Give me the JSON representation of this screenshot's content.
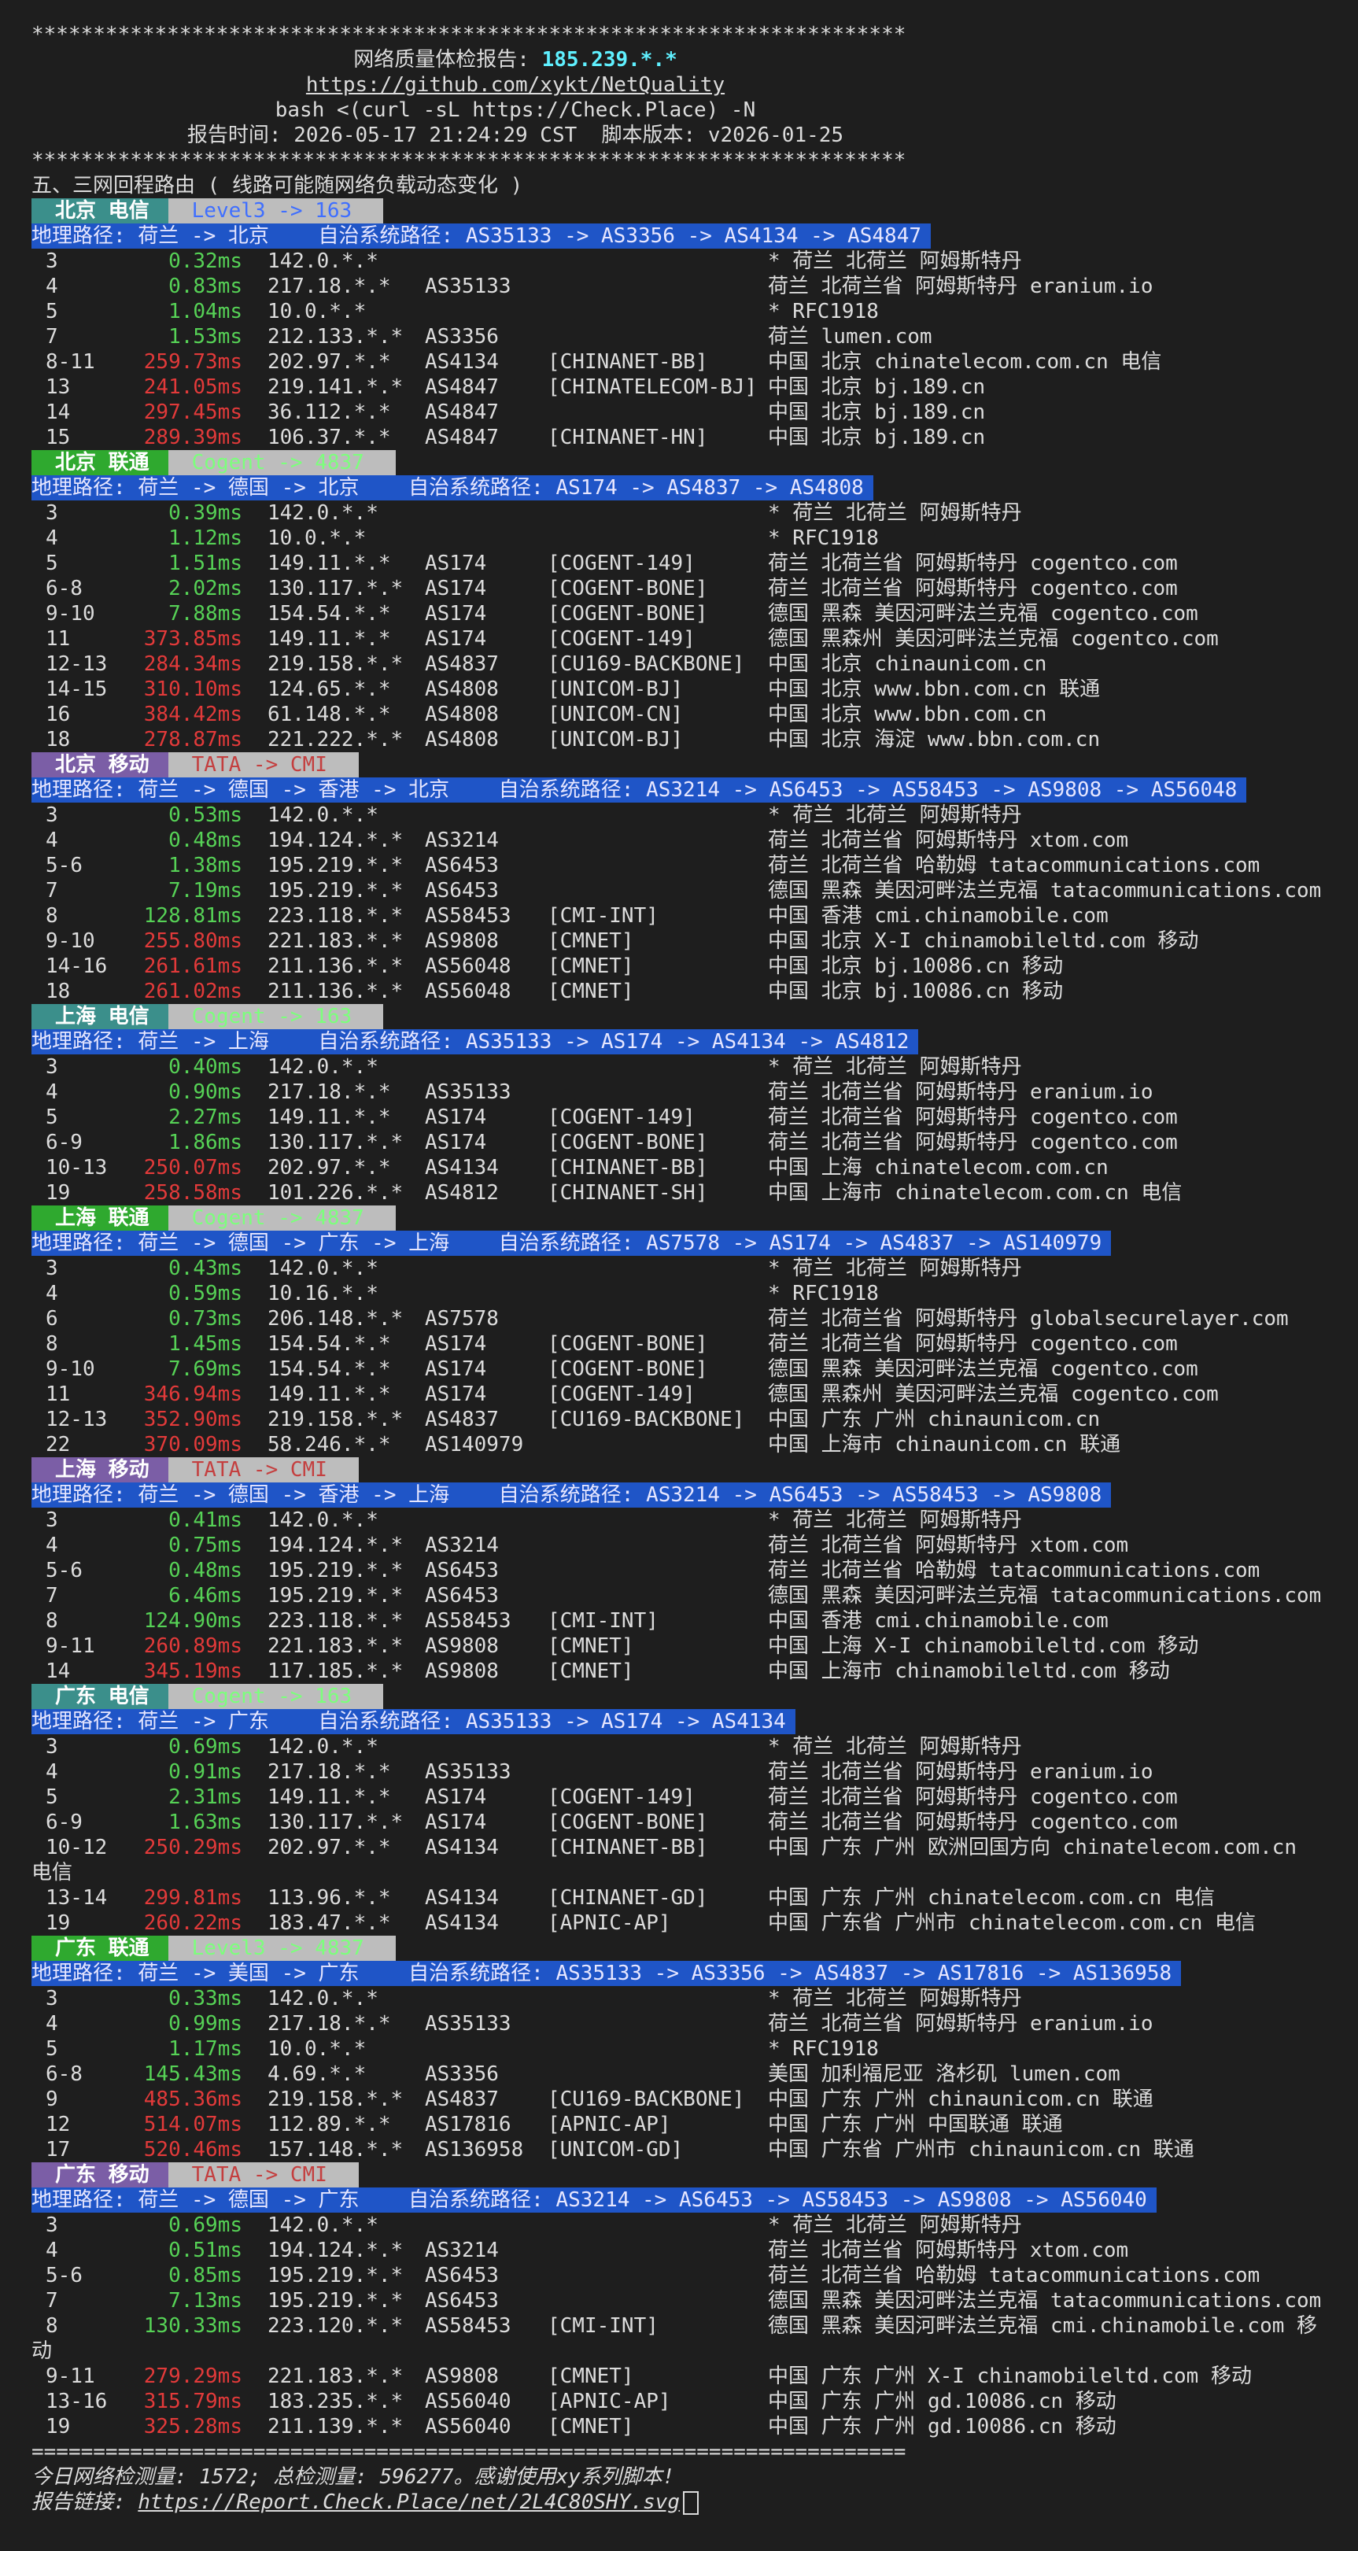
{
  "stars": "***********************************************************************",
  "header": {
    "title": "网络质量体检报告: ",
    "ip": "185.239.*.*",
    "repo": "https://github.com/xykt/NetQuality",
    "cmd": "bash <(curl -sL https://Check.Place) -N",
    "report_time": "报告时间: 2026-05-17 21:24:29 CST  脚本版本: v2026-01-25"
  },
  "section_title": "五、三网回程路由 ( 线路可能随网络负载动态变化 )",
  "routes": [
    {
      "label": "北京 电信",
      "carrier": "ct",
      "provider": "Level3 -> 163",
      "provider_style": "level3",
      "geo": "地理路径: 荷兰 -> 北京    自治系统路径: AS35133 -> AS3356 -> AS4134 -> AS4847",
      "hops": [
        {
          "n": "3",
          "ms": "0.32ms",
          "c": "g",
          "ip": "142.0.*.*",
          "as": "",
          "net": "",
          "loc": "* 荷兰 北荷兰 阿姆斯特丹"
        },
        {
          "n": "4",
          "ms": "0.83ms",
          "c": "g",
          "ip": "217.18.*.*",
          "as": "AS35133",
          "net": "",
          "loc": "荷兰 北荷兰省 阿姆斯特丹 eranium.io"
        },
        {
          "n": "5",
          "ms": "1.04ms",
          "c": "g",
          "ip": "10.0.*.*",
          "as": "",
          "net": "",
          "loc": "* RFC1918"
        },
        {
          "n": "7",
          "ms": "1.53ms",
          "c": "g",
          "ip": "212.133.*.*",
          "as": "AS3356",
          "net": "",
          "loc": "荷兰 lumen.com"
        },
        {
          "n": "8-11",
          "ms": "259.73ms",
          "c": "r",
          "ip": "202.97.*.*",
          "as": "AS4134",
          "net": "[CHINANET-BB]",
          "loc": "中国 北京 chinatelecom.com.cn 电信"
        },
        {
          "n": "13",
          "ms": "241.05ms",
          "c": "r",
          "ip": "219.141.*.*",
          "as": "AS4847",
          "net": "[CHINATELECOM-BJ]",
          "loc": "中国 北京 bj.189.cn"
        },
        {
          "n": "14",
          "ms": "297.45ms",
          "c": "r",
          "ip": "36.112.*.*",
          "as": "AS4847",
          "net": "",
          "loc": "中国 北京 bj.189.cn"
        },
        {
          "n": "15",
          "ms": "289.39ms",
          "c": "r",
          "ip": "106.37.*.*",
          "as": "AS4847",
          "net": "[CHINANET-HN]",
          "loc": "中国 北京 bj.189.cn"
        }
      ]
    },
    {
      "label": "北京 联通",
      "carrier": "cu",
      "provider": "Cogent -> 4837",
      "provider_style": "cogent",
      "geo": "地理路径: 荷兰 -> 德国 -> 北京    自治系统路径: AS174 -> AS4837 -> AS4808",
      "hops": [
        {
          "n": "3",
          "ms": "0.39ms",
          "c": "g",
          "ip": "142.0.*.*",
          "as": "",
          "net": "",
          "loc": "* 荷兰 北荷兰 阿姆斯特丹"
        },
        {
          "n": "4",
          "ms": "1.12ms",
          "c": "g",
          "ip": "10.0.*.*",
          "as": "",
          "net": "",
          "loc": "* RFC1918"
        },
        {
          "n": "5",
          "ms": "1.51ms",
          "c": "g",
          "ip": "149.11.*.*",
          "as": "AS174",
          "net": "[COGENT-149]",
          "loc": "荷兰 北荷兰省 阿姆斯特丹 cogentco.com"
        },
        {
          "n": "6-8",
          "ms": "2.02ms",
          "c": "g",
          "ip": "130.117.*.*",
          "as": "AS174",
          "net": "[COGENT-BONE]",
          "loc": "荷兰 北荷兰省 阿姆斯特丹 cogentco.com"
        },
        {
          "n": "9-10",
          "ms": "7.88ms",
          "c": "g",
          "ip": "154.54.*.*",
          "as": "AS174",
          "net": "[COGENT-BONE]",
          "loc": "德国 黑森 美因河畔法兰克福 cogentco.com"
        },
        {
          "n": "11",
          "ms": "373.85ms",
          "c": "r",
          "ip": "149.11.*.*",
          "as": "AS174",
          "net": "[COGENT-149]",
          "loc": "德国 黑森州 美因河畔法兰克福 cogentco.com"
        },
        {
          "n": "12-13",
          "ms": "284.34ms",
          "c": "r",
          "ip": "219.158.*.*",
          "as": "AS4837",
          "net": "[CU169-BACKBONE]",
          "loc": "中国 北京 chinaunicom.cn"
        },
        {
          "n": "14-15",
          "ms": "310.10ms",
          "c": "r",
          "ip": "124.65.*.*",
          "as": "AS4808",
          "net": "[UNICOM-BJ]",
          "loc": "中国 北京 www.bbn.com.cn 联通"
        },
        {
          "n": "16",
          "ms": "384.42ms",
          "c": "r",
          "ip": "61.148.*.*",
          "as": "AS4808",
          "net": "[UNICOM-CN]",
          "loc": "中国 北京 www.bbn.com.cn"
        },
        {
          "n": "18",
          "ms": "278.87ms",
          "c": "r",
          "ip": "221.222.*.*",
          "as": "AS4808",
          "net": "[UNICOM-BJ]",
          "loc": "中国 北京 海淀 www.bbn.com.cn"
        }
      ]
    },
    {
      "label": "北京 移动",
      "carrier": "cm",
      "provider": "TATA -> CMI",
      "provider_style": "tata",
      "geo": "地理路径: 荷兰 -> 德国 -> 香港 -> 北京    自治系统路径: AS3214 -> AS6453 -> AS58453 -> AS9808 -> AS56048",
      "hops": [
        {
          "n": "3",
          "ms": "0.53ms",
          "c": "g",
          "ip": "142.0.*.*",
          "as": "",
          "net": "",
          "loc": "* 荷兰 北荷兰 阿姆斯特丹"
        },
        {
          "n": "4",
          "ms": "0.48ms",
          "c": "g",
          "ip": "194.124.*.*",
          "as": "AS3214",
          "net": "",
          "loc": "荷兰 北荷兰省 阿姆斯特丹 xtom.com"
        },
        {
          "n": "5-6",
          "ms": "1.38ms",
          "c": "g",
          "ip": "195.219.*.*",
          "as": "AS6453",
          "net": "",
          "loc": "荷兰 北荷兰省 哈勒姆 tatacommunications.com"
        },
        {
          "n": "7",
          "ms": "7.19ms",
          "c": "g",
          "ip": "195.219.*.*",
          "as": "AS6453",
          "net": "",
          "loc": "德国 黑森 美因河畔法兰克福 tatacommunications.com"
        },
        {
          "n": "8",
          "ms": "128.81ms",
          "c": "g",
          "ip": "223.118.*.*",
          "as": "AS58453",
          "net": "[CMI-INT]",
          "loc": "中国 香港 cmi.chinamobile.com"
        },
        {
          "n": "9-10",
          "ms": "255.80ms",
          "c": "r",
          "ip": "221.183.*.*",
          "as": "AS9808",
          "net": "[CMNET]",
          "loc": "中国 北京 X-I chinamobileltd.com 移动"
        },
        {
          "n": "14-16",
          "ms": "261.61ms",
          "c": "r",
          "ip": "211.136.*.*",
          "as": "AS56048",
          "net": "[CMNET]",
          "loc": "中国 北京 bj.10086.cn 移动"
        },
        {
          "n": "18",
          "ms": "261.02ms",
          "c": "r",
          "ip": "211.136.*.*",
          "as": "AS56048",
          "net": "[CMNET]",
          "loc": "中国 北京 bj.10086.cn 移动"
        }
      ]
    },
    {
      "label": "上海 电信",
      "carrier": "ct",
      "provider": "Cogent -> 163",
      "provider_style": "cogent",
      "geo": "地理路径: 荷兰 -> 上海    自治系统路径: AS35133 -> AS174 -> AS4134 -> AS4812",
      "hops": [
        {
          "n": "3",
          "ms": "0.40ms",
          "c": "g",
          "ip": "142.0.*.*",
          "as": "",
          "net": "",
          "loc": "* 荷兰 北荷兰 阿姆斯特丹"
        },
        {
          "n": "4",
          "ms": "0.90ms",
          "c": "g",
          "ip": "217.18.*.*",
          "as": "AS35133",
          "net": "",
          "loc": "荷兰 北荷兰省 阿姆斯特丹 eranium.io"
        },
        {
          "n": "5",
          "ms": "2.27ms",
          "c": "g",
          "ip": "149.11.*.*",
          "as": "AS174",
          "net": "[COGENT-149]",
          "loc": "荷兰 北荷兰省 阿姆斯特丹 cogentco.com"
        },
        {
          "n": "6-9",
          "ms": "1.86ms",
          "c": "g",
          "ip": "130.117.*.*",
          "as": "AS174",
          "net": "[COGENT-BONE]",
          "loc": "荷兰 北荷兰省 阿姆斯特丹 cogentco.com"
        },
        {
          "n": "10-13",
          "ms": "250.07ms",
          "c": "r",
          "ip": "202.97.*.*",
          "as": "AS4134",
          "net": "[CHINANET-BB]",
          "loc": "中国 上海 chinatelecom.com.cn"
        },
        {
          "n": "19",
          "ms": "258.58ms",
          "c": "r",
          "ip": "101.226.*.*",
          "as": "AS4812",
          "net": "[CHINANET-SH]",
          "loc": "中国 上海市 chinatelecom.com.cn 电信"
        }
      ]
    },
    {
      "label": "上海 联通",
      "carrier": "cu",
      "provider": "Cogent -> 4837",
      "provider_style": "cogent",
      "geo": "地理路径: 荷兰 -> 德国 -> 广东 -> 上海    自治系统路径: AS7578 -> AS174 -> AS4837 -> AS140979",
      "hops": [
        {
          "n": "3",
          "ms": "0.43ms",
          "c": "g",
          "ip": "142.0.*.*",
          "as": "",
          "net": "",
          "loc": "* 荷兰 北荷兰 阿姆斯特丹"
        },
        {
          "n": "4",
          "ms": "0.59ms",
          "c": "g",
          "ip": "10.16.*.*",
          "as": "",
          "net": "",
          "loc": "* RFC1918"
        },
        {
          "n": "6",
          "ms": "0.73ms",
          "c": "g",
          "ip": "206.148.*.*",
          "as": "AS7578",
          "net": "",
          "loc": "荷兰 北荷兰省 阿姆斯特丹 globalsecurelayer.com"
        },
        {
          "n": "8",
          "ms": "1.45ms",
          "c": "g",
          "ip": "154.54.*.*",
          "as": "AS174",
          "net": "[COGENT-BONE]",
          "loc": "荷兰 北荷兰省 阿姆斯特丹 cogentco.com"
        },
        {
          "n": "9-10",
          "ms": "7.69ms",
          "c": "g",
          "ip": "154.54.*.*",
          "as": "AS174",
          "net": "[COGENT-BONE]",
          "loc": "德国 黑森 美因河畔法兰克福 cogentco.com"
        },
        {
          "n": "11",
          "ms": "346.94ms",
          "c": "r",
          "ip": "149.11.*.*",
          "as": "AS174",
          "net": "[COGENT-149]",
          "loc": "德国 黑森州 美因河畔法兰克福 cogentco.com"
        },
        {
          "n": "12-13",
          "ms": "352.90ms",
          "c": "r",
          "ip": "219.158.*.*",
          "as": "AS4837",
          "net": "[CU169-BACKBONE]",
          "loc": "中国 广东 广州 chinaunicom.cn"
        },
        {
          "n": "22",
          "ms": "370.09ms",
          "c": "r",
          "ip": "58.246.*.*",
          "as": "AS140979",
          "net": "",
          "loc": "中国 上海市 chinaunicom.cn 联通"
        }
      ]
    },
    {
      "label": "上海 移动",
      "carrier": "cm",
      "provider": "TATA -> CMI",
      "provider_style": "tata",
      "geo": "地理路径: 荷兰 -> 德国 -> 香港 -> 上海    自治系统路径: AS3214 -> AS6453 -> AS58453 -> AS9808",
      "hops": [
        {
          "n": "3",
          "ms": "0.41ms",
          "c": "g",
          "ip": "142.0.*.*",
          "as": "",
          "net": "",
          "loc": "* 荷兰 北荷兰 阿姆斯特丹"
        },
        {
          "n": "4",
          "ms": "0.75ms",
          "c": "g",
          "ip": "194.124.*.*",
          "as": "AS3214",
          "net": "",
          "loc": "荷兰 北荷兰省 阿姆斯特丹 xtom.com"
        },
        {
          "n": "5-6",
          "ms": "0.48ms",
          "c": "g",
          "ip": "195.219.*.*",
          "as": "AS6453",
          "net": "",
          "loc": "荷兰 北荷兰省 哈勒姆 tatacommunications.com"
        },
        {
          "n": "7",
          "ms": "6.46ms",
          "c": "g",
          "ip": "195.219.*.*",
          "as": "AS6453",
          "net": "",
          "loc": "德国 黑森 美因河畔法兰克福 tatacommunications.com"
        },
        {
          "n": "8",
          "ms": "124.90ms",
          "c": "g",
          "ip": "223.118.*.*",
          "as": "AS58453",
          "net": "[CMI-INT]",
          "loc": "中国 香港 cmi.chinamobile.com"
        },
        {
          "n": "9-11",
          "ms": "260.89ms",
          "c": "r",
          "ip": "221.183.*.*",
          "as": "AS9808",
          "net": "[CMNET]",
          "loc": "中国 上海 X-I chinamobileltd.com 移动"
        },
        {
          "n": "14",
          "ms": "345.19ms",
          "c": "r",
          "ip": "117.185.*.*",
          "as": "AS9808",
          "net": "[CMNET]",
          "loc": "中国 上海市 chinamobileltd.com 移动"
        }
      ]
    },
    {
      "label": "广东 电信",
      "carrier": "ct",
      "provider": "Cogent -> 163",
      "provider_style": "cogent",
      "geo": "地理路径: 荷兰 -> 广东    自治系统路径: AS35133 -> AS174 -> AS4134",
      "hops": [
        {
          "n": "3",
          "ms": "0.69ms",
          "c": "g",
          "ip": "142.0.*.*",
          "as": "",
          "net": "",
          "loc": "* 荷兰 北荷兰 阿姆斯特丹"
        },
        {
          "n": "4",
          "ms": "0.91ms",
          "c": "g",
          "ip": "217.18.*.*",
          "as": "AS35133",
          "net": "",
          "loc": "荷兰 北荷兰省 阿姆斯特丹 eranium.io"
        },
        {
          "n": "5",
          "ms": "2.31ms",
          "c": "g",
          "ip": "149.11.*.*",
          "as": "AS174",
          "net": "[COGENT-149]",
          "loc": "荷兰 北荷兰省 阿姆斯特丹 cogentco.com"
        },
        {
          "n": "6-9",
          "ms": "1.63ms",
          "c": "g",
          "ip": "130.117.*.*",
          "as": "AS174",
          "net": "[COGENT-BONE]",
          "loc": "荷兰 北荷兰省 阿姆斯特丹 cogentco.com"
        },
        {
          "n": "10-12",
          "ms": "250.29ms",
          "c": "r",
          "ip": "202.97.*.*",
          "as": "AS4134",
          "net": "[CHINANET-BB]",
          "loc": "中国 广东 广州 欧洲回国方向 chinatelecom.com.cn",
          "wrap": "电信"
        },
        {
          "n": "13-14",
          "ms": "299.81ms",
          "c": "r",
          "ip": "113.96.*.*",
          "as": "AS4134",
          "net": "[CHINANET-GD]",
          "loc": "中国 广东 广州 chinatelecom.com.cn 电信"
        },
        {
          "n": "19",
          "ms": "260.22ms",
          "c": "r",
          "ip": "183.47.*.*",
          "as": "AS4134",
          "net": "[APNIC-AP]",
          "loc": "中国 广东省 广州市 chinatelecom.com.cn 电信"
        }
      ]
    },
    {
      "label": "广东 联通",
      "carrier": "cu",
      "provider": "Level3 -> 4837",
      "provider_style": "cogent",
      "geo": "地理路径: 荷兰 -> 美国 -> 广东    自治系统路径: AS35133 -> AS3356 -> AS4837 -> AS17816 -> AS136958",
      "hops": [
        {
          "n": "3",
          "ms": "0.33ms",
          "c": "g",
          "ip": "142.0.*.*",
          "as": "",
          "net": "",
          "loc": "* 荷兰 北荷兰 阿姆斯特丹"
        },
        {
          "n": "4",
          "ms": "0.99ms",
          "c": "g",
          "ip": "217.18.*.*",
          "as": "AS35133",
          "net": "",
          "loc": "荷兰 北荷兰省 阿姆斯特丹 eranium.io"
        },
        {
          "n": "5",
          "ms": "1.17ms",
          "c": "g",
          "ip": "10.0.*.*",
          "as": "",
          "net": "",
          "loc": "* RFC1918"
        },
        {
          "n": "6-8",
          "ms": "145.43ms",
          "c": "g",
          "ip": "4.69.*.*",
          "as": "AS3356",
          "net": "",
          "loc": "美国 加利福尼亚 洛杉矶 lumen.com"
        },
        {
          "n": "9",
          "ms": "485.36ms",
          "c": "r",
          "ip": "219.158.*.*",
          "as": "AS4837",
          "net": "[CU169-BACKBONE]",
          "loc": "中国 广东 广州 chinaunicom.cn 联通"
        },
        {
          "n": "12",
          "ms": "514.07ms",
          "c": "r",
          "ip": "112.89.*.*",
          "as": "AS17816",
          "net": "[APNIC-AP]",
          "loc": "中国 广东 广州 中国联通 联通"
        },
        {
          "n": "17",
          "ms": "520.46ms",
          "c": "r",
          "ip": "157.148.*.*",
          "as": "AS136958",
          "net": "[UNICOM-GD]",
          "loc": "中国 广东省 广州市 chinaunicom.cn 联通"
        }
      ]
    },
    {
      "label": "广东 移动",
      "carrier": "cm",
      "provider": "TATA -> CMI",
      "provider_style": "tata",
      "geo": "地理路径: 荷兰 -> 德国 -> 广东    自治系统路径: AS3214 -> AS6453 -> AS58453 -> AS9808 -> AS56040",
      "hops": [
        {
          "n": "3",
          "ms": "0.69ms",
          "c": "g",
          "ip": "142.0.*.*",
          "as": "",
          "net": "",
          "loc": "* 荷兰 北荷兰 阿姆斯特丹"
        },
        {
          "n": "4",
          "ms": "0.51ms",
          "c": "g",
          "ip": "194.124.*.*",
          "as": "AS3214",
          "net": "",
          "loc": "荷兰 北荷兰省 阿姆斯特丹 xtom.com"
        },
        {
          "n": "5-6",
          "ms": "0.85ms",
          "c": "g",
          "ip": "195.219.*.*",
          "as": "AS6453",
          "net": "",
          "loc": "荷兰 北荷兰省 哈勒姆 tatacommunications.com"
        },
        {
          "n": "7",
          "ms": "7.13ms",
          "c": "g",
          "ip": "195.219.*.*",
          "as": "AS6453",
          "net": "",
          "loc": "德国 黑森 美因河畔法兰克福 tatacommunications.com"
        },
        {
          "n": "8",
          "ms": "130.33ms",
          "c": "g",
          "ip": "223.120.*.*",
          "as": "AS58453",
          "net": "[CMI-INT]",
          "loc": "德国 黑森 美因河畔法兰克福 cmi.chinamobile.com 移",
          "wrap": "动"
        },
        {
          "n": "9-11",
          "ms": "279.29ms",
          "c": "r",
          "ip": "221.183.*.*",
          "as": "AS9808",
          "net": "[CMNET]",
          "loc": "中国 广东 广州 X-I chinamobileltd.com 移动"
        },
        {
          "n": "13-16",
          "ms": "315.79ms",
          "c": "r",
          "ip": "183.235.*.*",
          "as": "AS56040",
          "net": "[APNIC-AP]",
          "loc": "中国 广东 广州 gd.10086.cn 移动"
        },
        {
          "n": "19",
          "ms": "325.28ms",
          "c": "r",
          "ip": "211.139.*.*",
          "as": "AS56040",
          "net": "[CMNET]",
          "loc": "中国 广东 广州 gd.10086.cn 移动"
        }
      ]
    }
  ],
  "separator": "=======================================================================",
  "footer": {
    "stats": "今日网络检测量: 1572; 总检测量: 596277。感谢使用xy系列脚本!",
    "link_label": "报告链接: ",
    "link": "https://Report.Check.Place/net/2L4C80SHY.svg"
  },
  "colors": {
    "background": "#1e1e1e",
    "text": "#dcdcdc",
    "geo_bar": "#1f55c7",
    "ms_low": "#56d256",
    "ms_high": "#e23a3a",
    "ip_highlight": "#5ff0ff"
  }
}
